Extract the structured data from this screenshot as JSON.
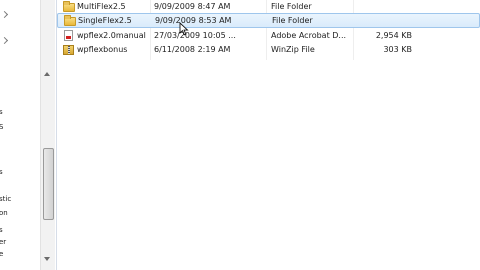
{
  "nav": {
    "items": [
      {
        "label": "s"
      },
      {
        "label": "S"
      },
      {
        "label": "s"
      },
      {
        "label": "stic"
      },
      {
        "label": "on"
      },
      {
        "label": "s"
      },
      {
        "label": "er"
      },
      {
        "label": "e"
      }
    ]
  },
  "files": [
    {
      "name": "MultiFlex2.5",
      "date": "9/09/2009 8:47 AM",
      "type": "File Folder",
      "size": "",
      "icon": "folder-icon",
      "selected": false
    },
    {
      "name": "SingleFlex2.5",
      "date": "9/09/2009 8:53 AM",
      "type": "File Folder",
      "size": "",
      "icon": "folder-icon",
      "selected": true
    },
    {
      "name": "wpflex2.0manual",
      "date": "27/03/2009 10:05 ...",
      "type": "Adobe Acrobat D...",
      "size": "2,954 KB",
      "icon": "pdf-icon",
      "selected": false
    },
    {
      "name": "wpflexbonus",
      "date": "6/11/2008 2:19 AM",
      "type": "WinZip File",
      "size": "303 KB",
      "icon": "zip-icon",
      "selected": false
    }
  ],
  "colors": {
    "selection": "#d9ebfb",
    "selection_border": "#9fc6ec"
  }
}
